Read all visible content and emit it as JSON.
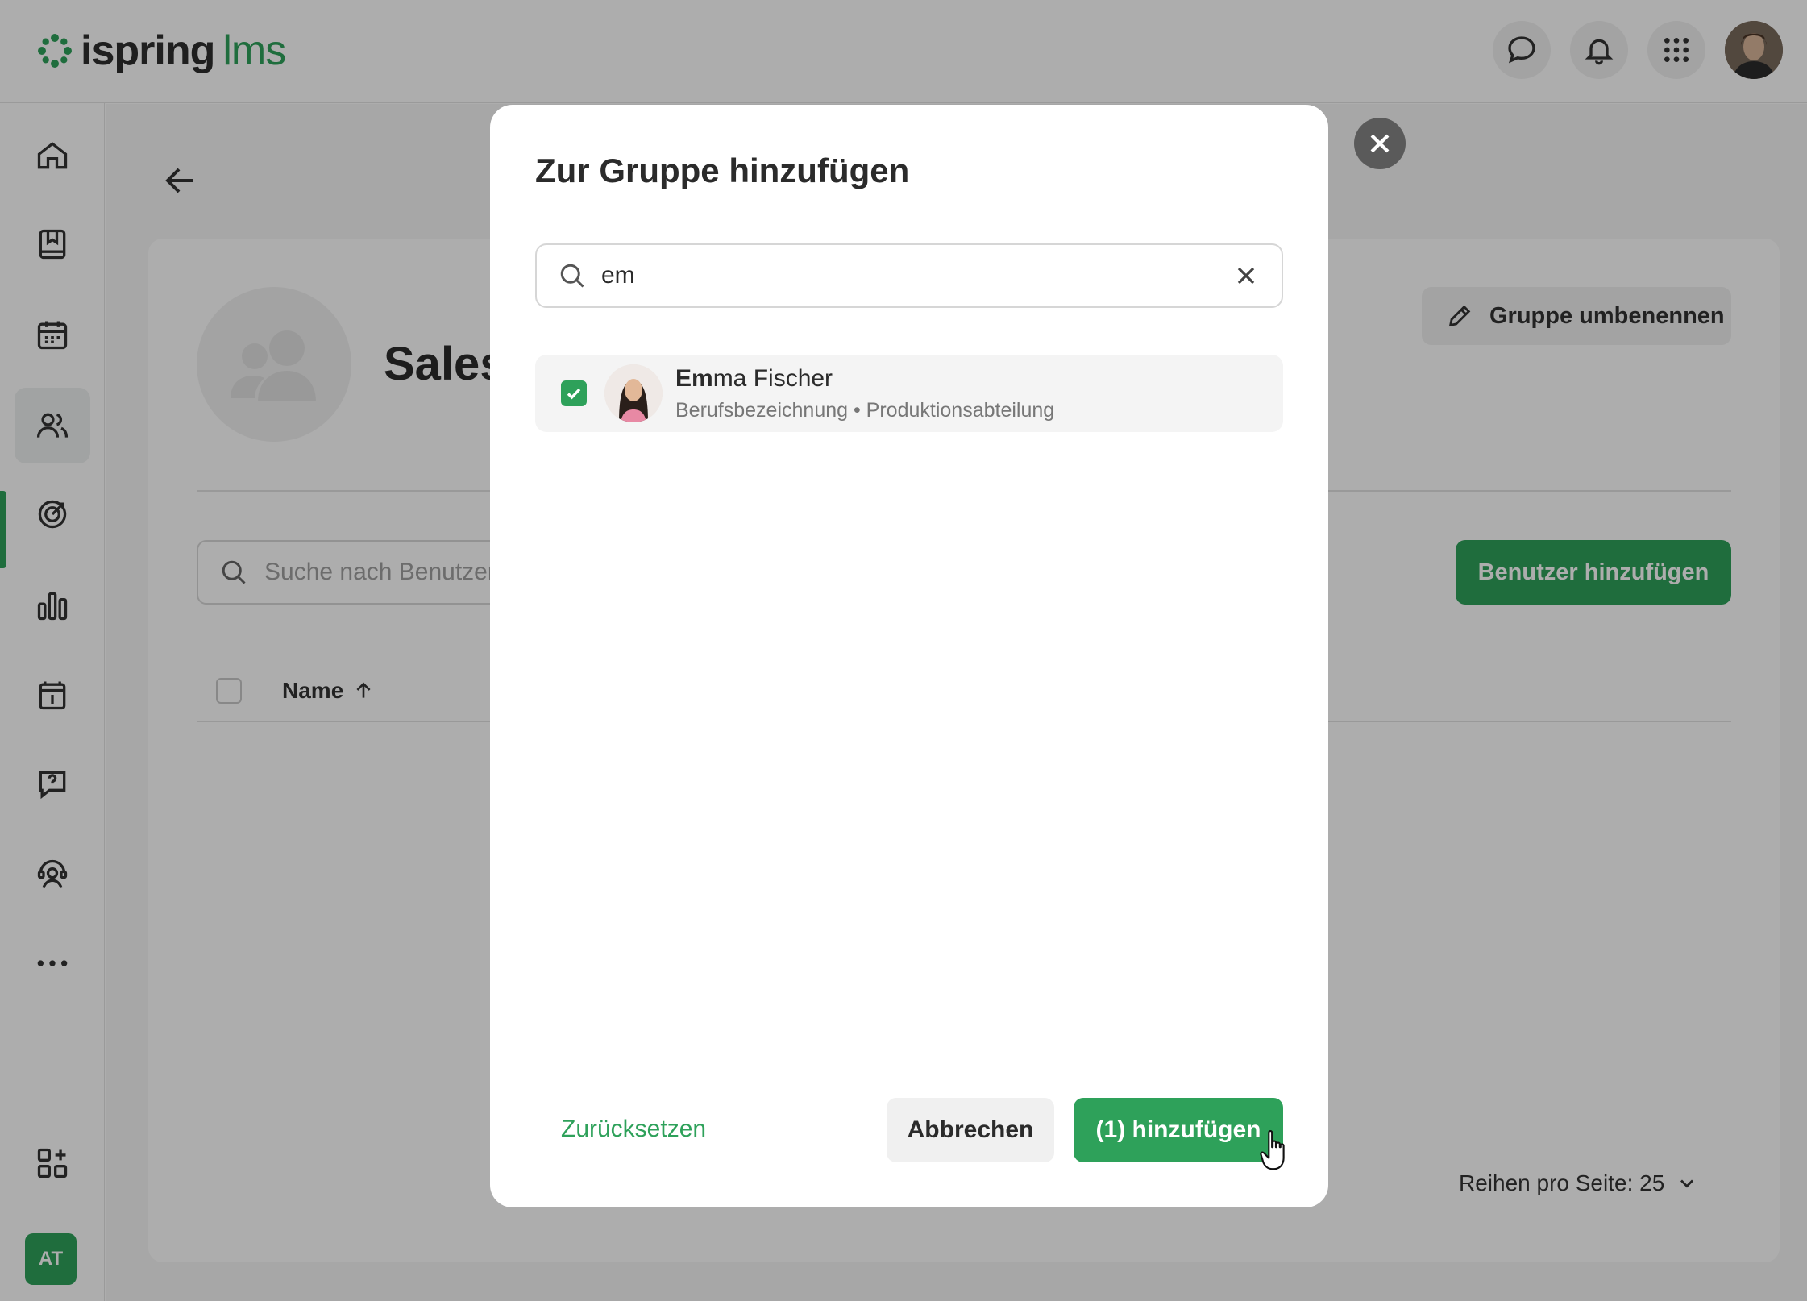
{
  "colors": {
    "accent": "#2ea15a",
    "overlay": "rgba(0,0,0,0.32)"
  },
  "topbar": {
    "logo_text": "ispring",
    "logo_suffix": "lms",
    "icons": [
      "chat-icon",
      "bell-icon",
      "apps-grid-icon",
      "user-avatar"
    ]
  },
  "sidebar": {
    "items": [
      {
        "icon": "home-icon"
      },
      {
        "icon": "book-icon"
      },
      {
        "icon": "calendar-icon"
      },
      {
        "icon": "users-icon",
        "active": true
      },
      {
        "icon": "target-icon"
      },
      {
        "icon": "bar-chart-icon"
      },
      {
        "icon": "info-board-icon"
      },
      {
        "icon": "help-chat-icon"
      },
      {
        "icon": "support-agent-icon"
      },
      {
        "icon": "more-icon"
      },
      {
        "icon": "add-widget-icon"
      }
    ],
    "account_badge": "AT"
  },
  "page": {
    "group_title": "Sales",
    "rename_button": "Gruppe umbenennen",
    "search_placeholder": "Suche nach Benutzer",
    "add_users_button": "Benutzer hinzufügen",
    "column_name": "Name",
    "rows_per_page": "Reihen pro Seite: 25"
  },
  "modal": {
    "title": "Zur Gruppe hinzufügen",
    "search_value": "em",
    "results": [
      {
        "name_match": "Em",
        "name_rest": "ma Fischer",
        "meta": "Berufsbezeichnung • Produktionsabteilung",
        "checked": true
      }
    ],
    "reset_label": "Zurücksetzen",
    "cancel_label": "Abbrechen",
    "confirm_label": "(1) hinzufügen"
  }
}
